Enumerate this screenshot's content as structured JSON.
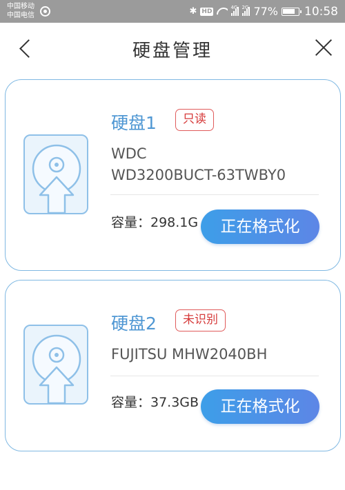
{
  "status_bar": {
    "carrier_1": "中国移动",
    "carrier_2": "中国电信",
    "hd_label": "HD",
    "signal_1_tag": "4G",
    "signal_2_tag": "2G",
    "battery": "77%",
    "time": "10:58"
  },
  "nav": {
    "title": "硬盘管理"
  },
  "disks": [
    {
      "name": "硬盘1",
      "status": "只读",
      "model_line_1": "WDC",
      "model_line_2": "WD3200BUCT-63TWBY0",
      "capacity": "容量：298.1G",
      "action": "正在格式化"
    },
    {
      "name": "硬盘2",
      "status": "未识别",
      "model_line_1": "FUJITSU MHW2040BH",
      "capacity": "容量：37.3GB",
      "action": "正在格式化"
    }
  ],
  "colors": {
    "accent": "#4f97d3",
    "badge": "#d63a3a",
    "button_start": "#3d9ee8",
    "button_end": "#5d86e6",
    "card_border": "#7fb8e2"
  }
}
